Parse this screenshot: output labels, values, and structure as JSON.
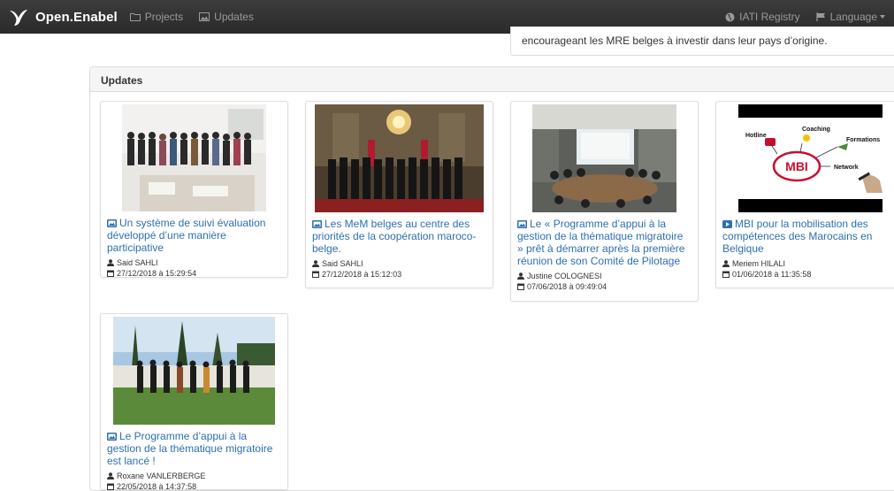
{
  "navbar": {
    "brand": "Open.Enabel",
    "links": [
      {
        "label": "Projects",
        "icon": "folder-icon"
      },
      {
        "label": "Updates",
        "icon": "image-icon"
      }
    ],
    "right": [
      {
        "label": "IATI Registry",
        "icon": "globe-icon"
      },
      {
        "label": "Language",
        "icon": "flag-icon"
      }
    ]
  },
  "top_panel": {
    "text": "encourageant les MRE belges à investir dans leur pays d’origine."
  },
  "updates": {
    "heading": "Updates",
    "items": [
      {
        "title": "Un système de suivi évaluation développé d’une manière participative",
        "icon": "photo-icon",
        "author": "Said SAHLI",
        "date": "27/12/2018 à 15:29:54"
      },
      {
        "title": "Les MeM belges au centre des priorités de la coopération maroco-belge.",
        "icon": "photo-icon",
        "author": "Said SAHLI",
        "date": "27/12/2018 à 15:12:03"
      },
      {
        "title": "Le « Programme d’appui à la gestion de la thématique migratoire » prêt à démarrer après la première réunion de son Comité de Pilotage",
        "icon": "photo-icon",
        "author": "Justine COLOGNESI",
        "date": "07/06/2018 à 09:49:04"
      },
      {
        "title": "MBI pour la mobilisation des compétences des Marocains en Belgique",
        "icon": "video-icon",
        "author": "Meriem HILALI",
        "date": "01/06/2018 à 11:35:58",
        "thumb_labels": [
          "Hotline",
          "Coaching",
          "Formations",
          "MBI",
          "Network"
        ]
      },
      {
        "title": "Le Programme d’appui à la gestion de la thématique migratoire est lancé !",
        "icon": "photo-icon",
        "author": "Roxane VANLERBERGE",
        "date": "22/05/2018 à 14:37:58"
      }
    ]
  },
  "colors": {
    "navbar": "#2f2f2f",
    "link": "#2d6fb0",
    "mbi_red": "#c8102e"
  }
}
